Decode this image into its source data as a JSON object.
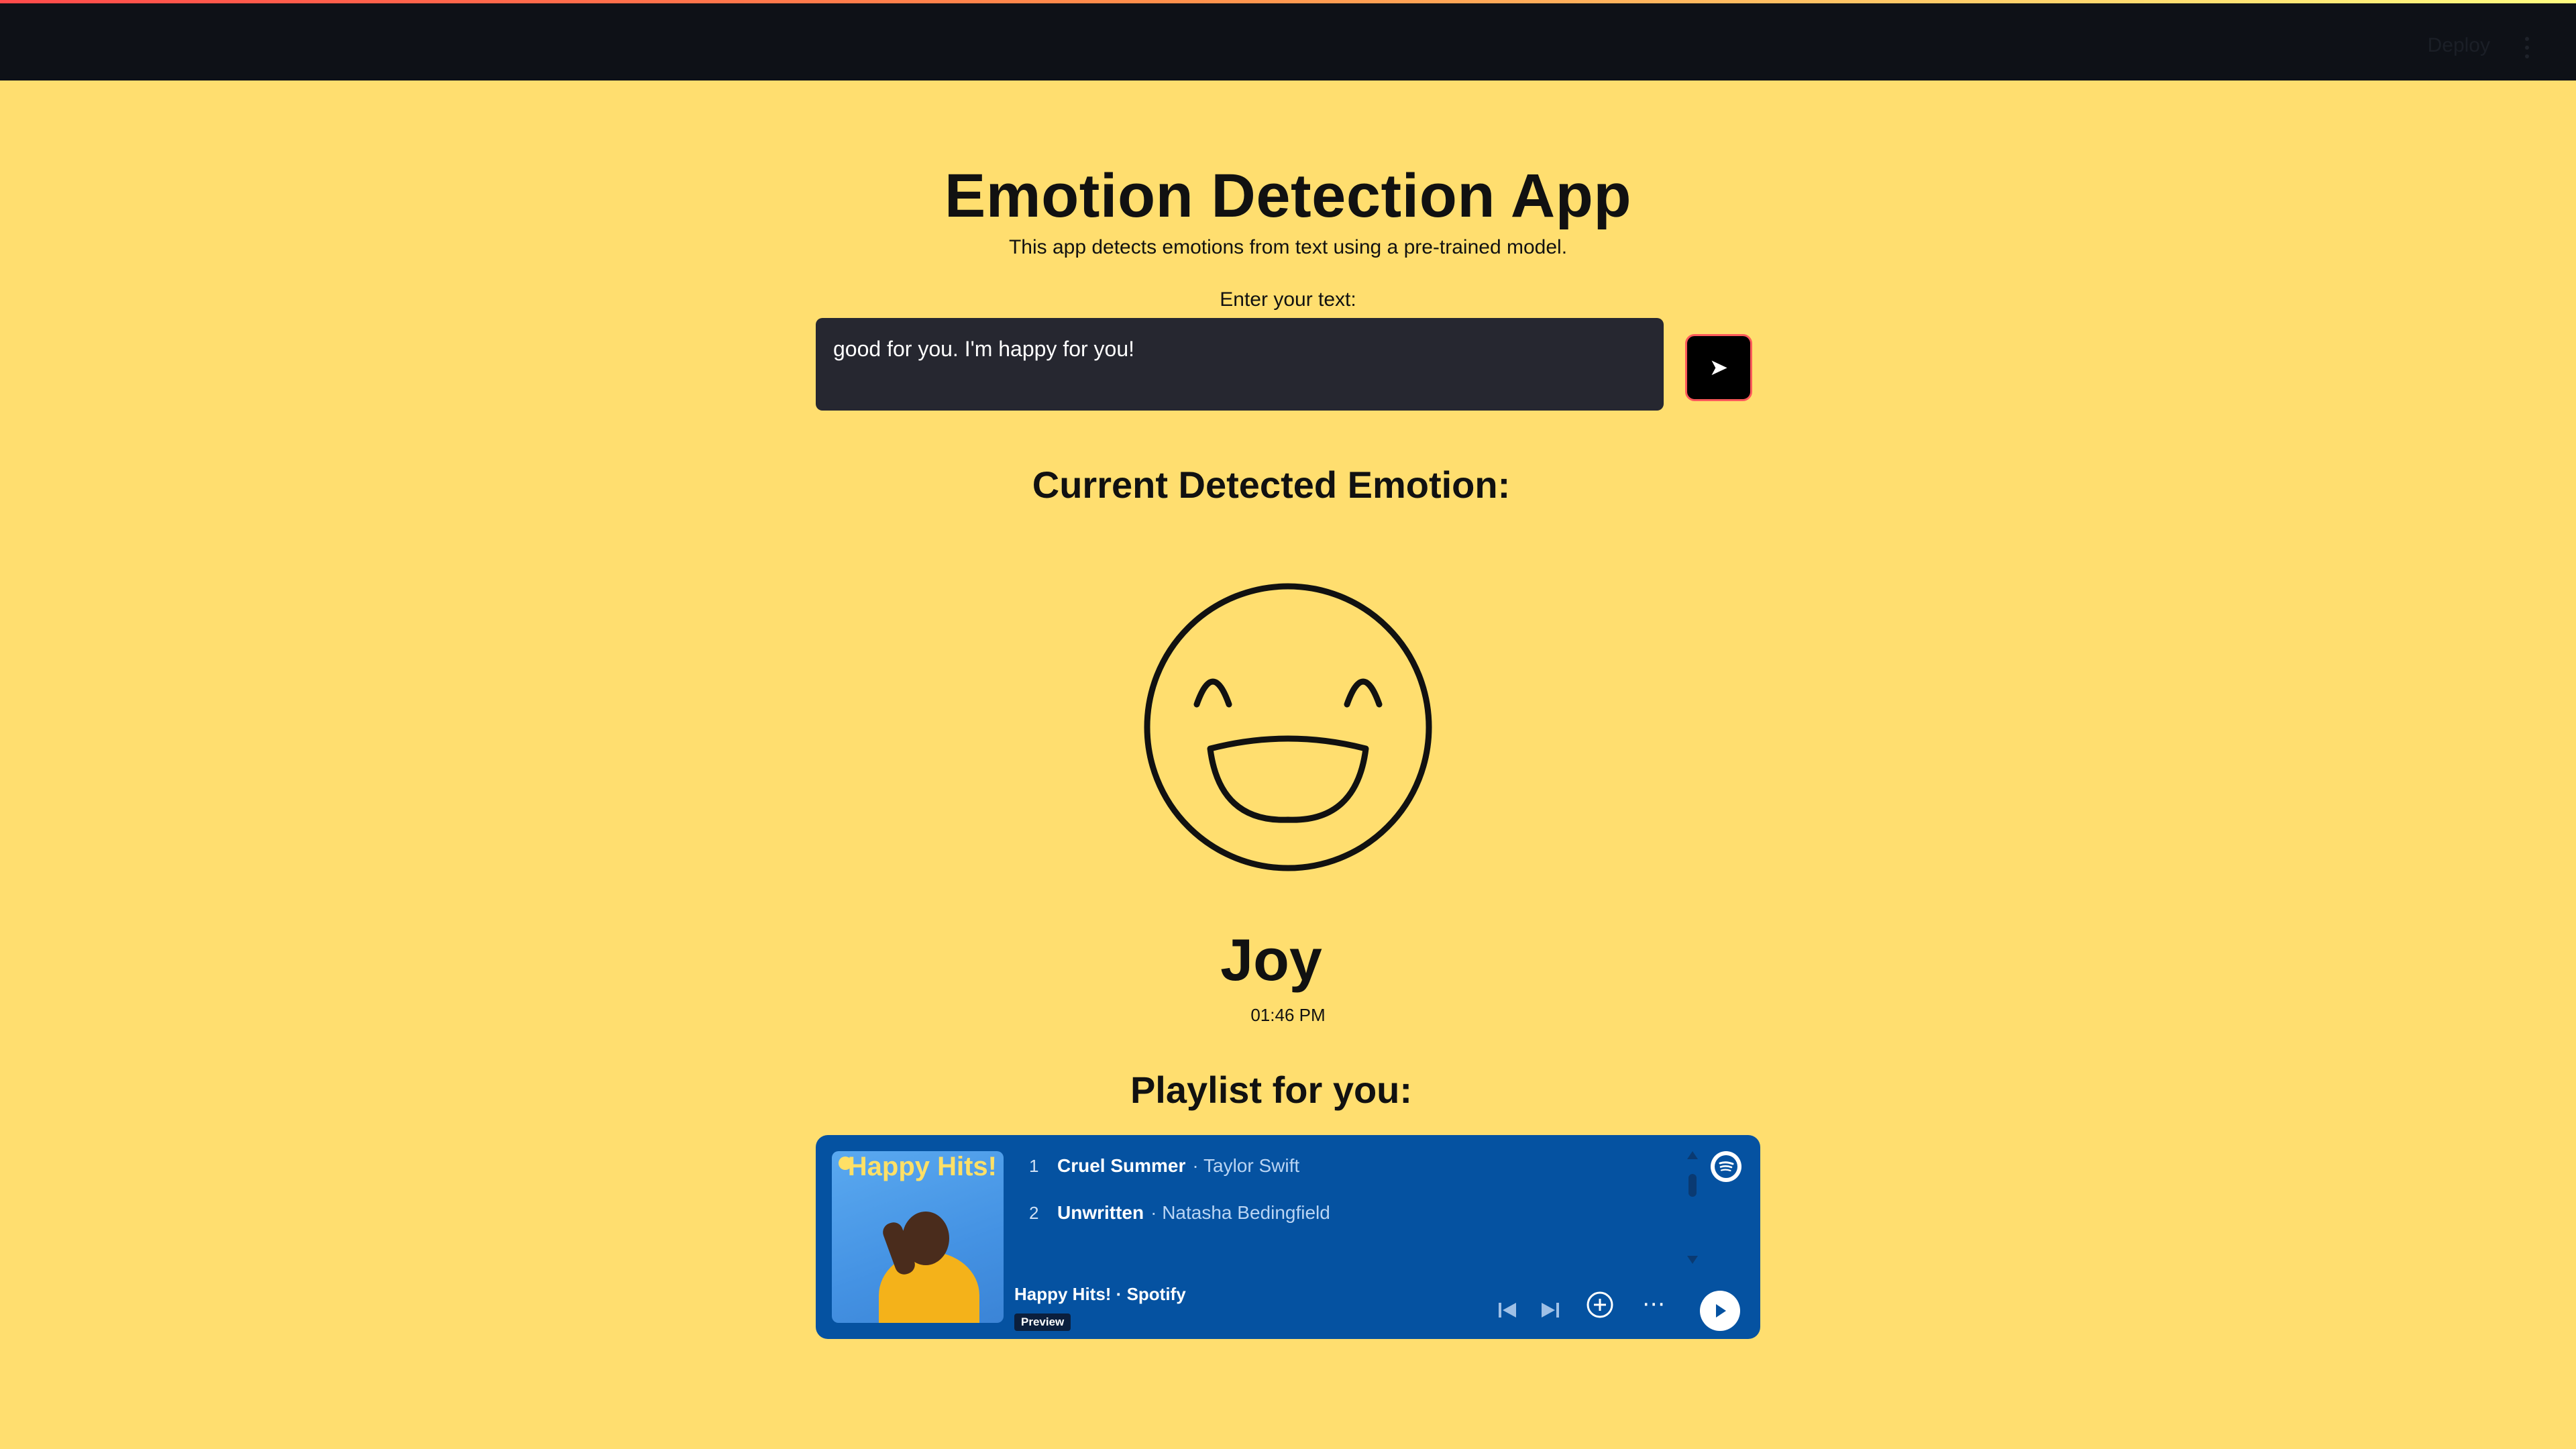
{
  "header": {
    "deploy_label": "Deploy"
  },
  "app": {
    "title": "Emotion Detection App",
    "subtitle": "This app detects emotions from text using a pre-trained model.",
    "input_label": "Enter your text:",
    "input_value": "good for you. I'm happy for you!",
    "send_icon": "send-arrow"
  },
  "result": {
    "heading": "Current Detected Emotion:",
    "emotion": "Joy",
    "time": "01:46 PM",
    "emoji_icon": "laughing-face"
  },
  "playlist": {
    "heading": "Playlist for you:",
    "cover_title": "Happy Hits!",
    "name": "Happy Hits! · Spotify",
    "preview_badge": "Preview",
    "tracks": [
      {
        "num": "1",
        "name": "Cruel Summer",
        "artist": "· Taylor Swift"
      },
      {
        "num": "2",
        "name": "Unwritten",
        "artist": "· Natasha Bedingfield"
      }
    ],
    "accent_color": "#0552a1"
  },
  "colors": {
    "background": "#ffde6f",
    "topbar": "#0e1117",
    "textbox": "#262730"
  }
}
